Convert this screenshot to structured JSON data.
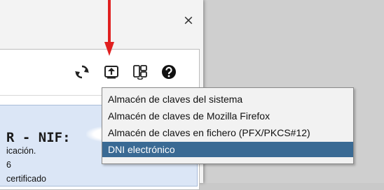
{
  "dialog": {
    "close_glyph": "×"
  },
  "toolbar": {
    "icons": [
      "refresh-icon",
      "import-certificate-icon",
      "certificate-store-icon",
      "help-icon"
    ]
  },
  "certificate": {
    "title": "R - NIF:",
    "line1": "icación.",
    "line2": "6",
    "line3": "certificado"
  },
  "import_menu": {
    "items": [
      "Almacén de claves del sistema",
      "Almacén de claves de Mozilla Firefox",
      "Almacén de claves en fichero (PFX/PKCS#12)",
      "DNI electrónico"
    ],
    "selected_index": 3
  },
  "colors": {
    "menu_highlight": "#3a6a94",
    "arrow": "#e02020",
    "card_background": "#dbe6f6"
  }
}
